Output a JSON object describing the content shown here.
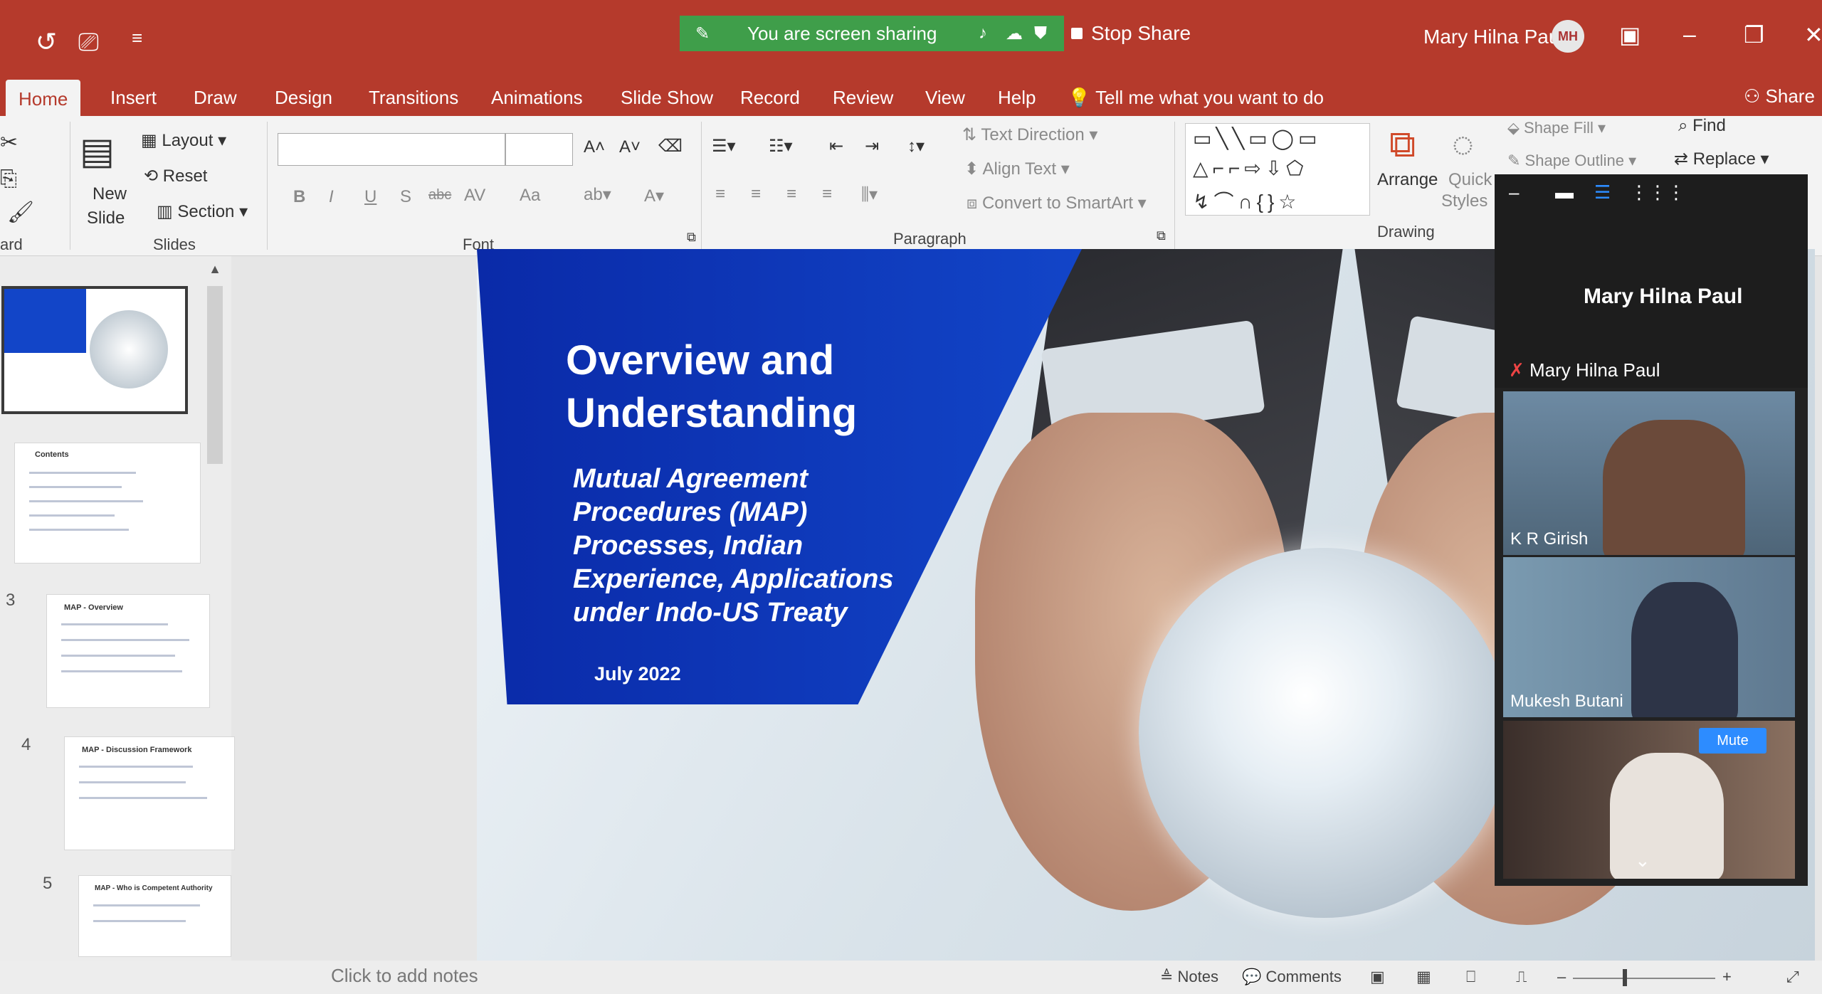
{
  "titlebar": {
    "share_status": "You are screen sharing",
    "stop_share": "Stop Share",
    "user_name": "Mary Hilna Paul",
    "avatar_initials": "MH"
  },
  "tabs": [
    "Home",
    "Insert",
    "Draw",
    "Design",
    "Transitions",
    "Animations",
    "Slide Show",
    "Record",
    "Review",
    "View",
    "Help"
  ],
  "tell_me": "Tell me what you want to do",
  "share_label": "Share",
  "ribbon": {
    "clipboard_label": "ard",
    "slides": {
      "new_slide_1": "New",
      "new_slide_2": "Slide",
      "layout": "Layout",
      "reset": "Reset",
      "section": "Section",
      "group": "Slides"
    },
    "font": {
      "group": "Font",
      "bold": "B",
      "italic": "I",
      "underline": "U",
      "shadow": "S",
      "strike": "abc",
      "spacing": "AV",
      "case": "Aa"
    },
    "paragraph": {
      "group": "Paragraph",
      "text_direction": "Text Direction",
      "align_text": "Align Text",
      "smartart": "Convert to SmartArt"
    },
    "drawing": {
      "group": "Drawing",
      "arrange": "Arrange",
      "quick_1": "Quick",
      "quick_2": "Styles",
      "shape_fill": "Shape Fill",
      "shape_outline": "Shape Outline"
    },
    "editing": {
      "find": "Find",
      "replace": "Replace"
    }
  },
  "thumbnails": [
    {
      "num": "",
      "title": ""
    },
    {
      "num": "",
      "title": "Contents"
    },
    {
      "num": "3",
      "title": "MAP - Overview"
    },
    {
      "num": "4",
      "title": "MAP - Discussion Framework"
    },
    {
      "num": "5",
      "title": "MAP - Who is Competent Authority"
    }
  ],
  "slide": {
    "title": "Overview and Understanding",
    "subtitle": "Mutual Agreement Procedures (MAP) Processes, Indian Experience, Applications under Indo-US Treaty",
    "date": "July 2022"
  },
  "video": {
    "host": "Mary Hilna Paul",
    "participants": [
      "Mary Hilna Paul",
      "K R Girish",
      "Mukesh Butani"
    ],
    "mute": "Mute"
  },
  "status": {
    "notes_placeholder": "Click to add notes",
    "notes": "Notes",
    "comments": "Comments"
  },
  "colors": {
    "ppt_red": "#b53a2c",
    "share_green": "#3f9e4a",
    "slide_blue": "#1245c8",
    "zoom_blue": "#2d8cff"
  }
}
